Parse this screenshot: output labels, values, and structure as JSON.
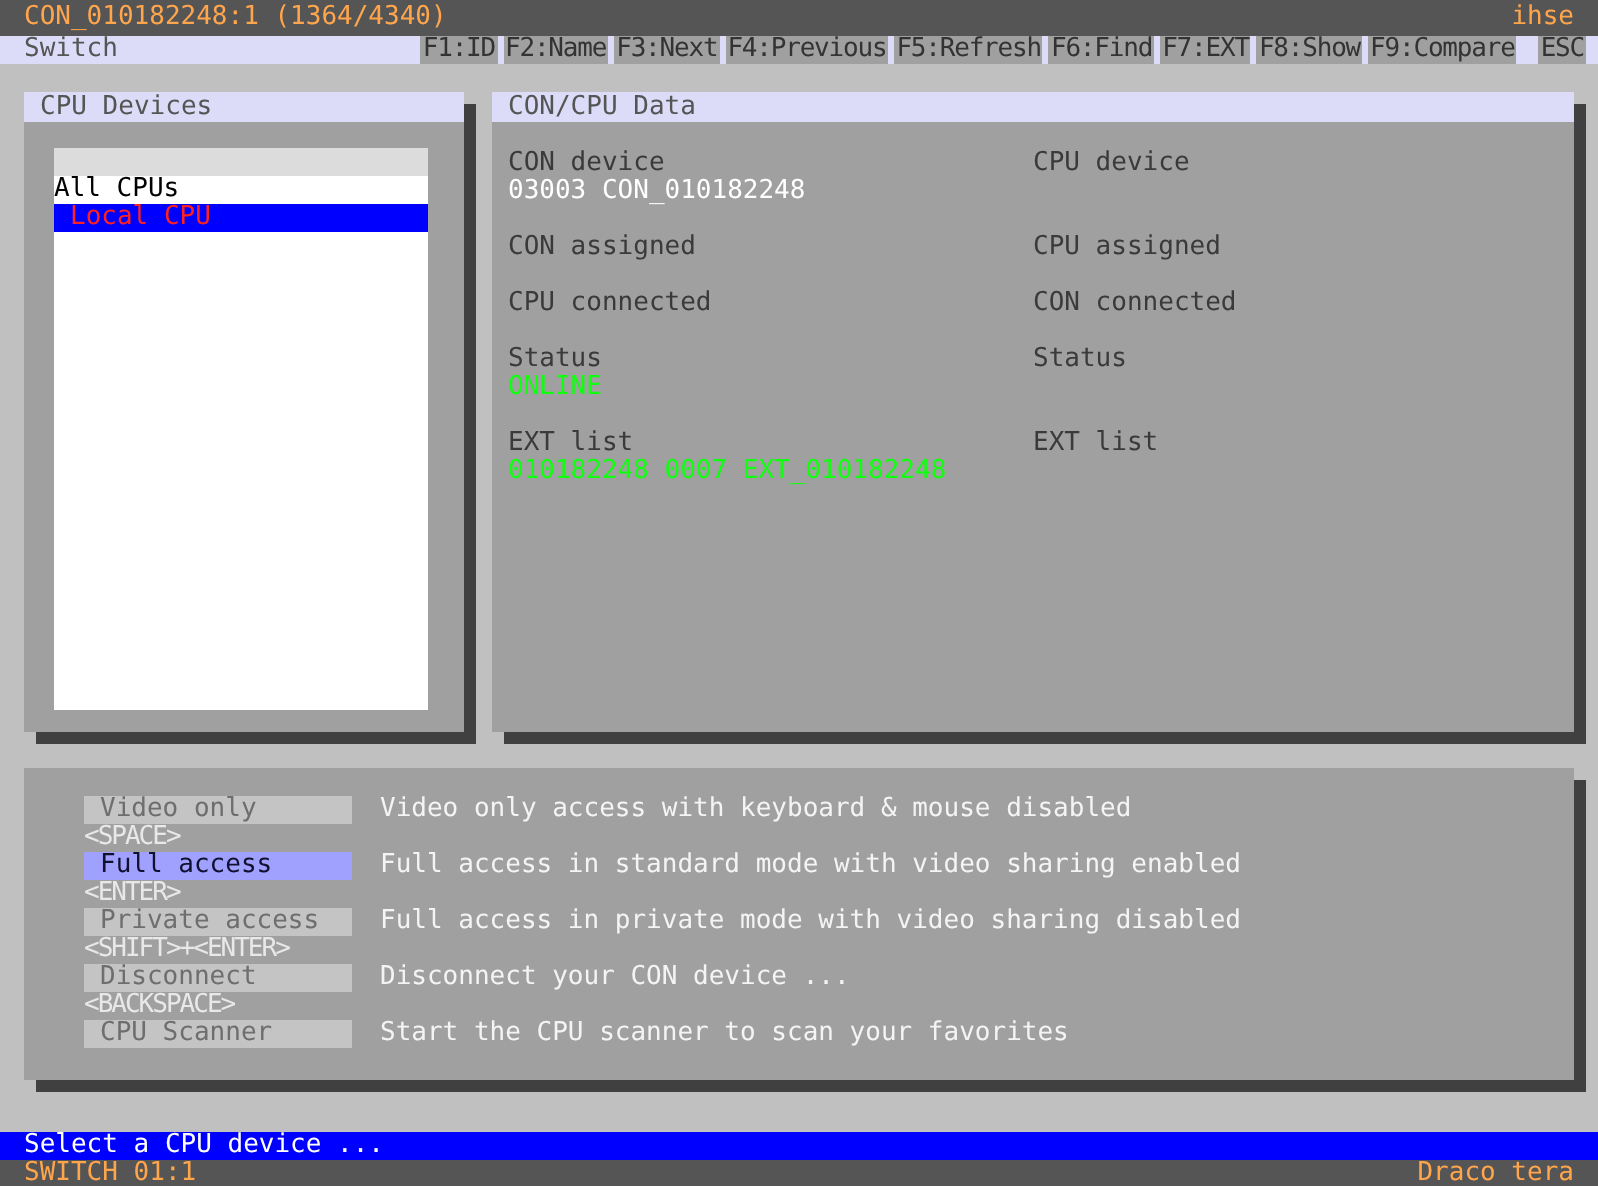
{
  "title_bar": {
    "title": "CON_010182248:1 (1364/4340)",
    "brand": "ihse"
  },
  "menu_bar": {
    "title": "Switch",
    "keys": [
      "F1:ID",
      "F2:Name",
      "F3:Next",
      "F4:Previous",
      "F5:Refresh",
      "F6:Find",
      "F7:EXT",
      "F8:Show",
      "F9:Compare",
      "ESC"
    ]
  },
  "cpu_devices": {
    "title": "CPU Devices",
    "items": [
      {
        "label": "All CPUs",
        "selected": false
      },
      {
        "label": "Local CPU",
        "selected": true
      }
    ]
  },
  "con_cpu_data": {
    "title": "CON/CPU Data",
    "rows": [
      [
        {
          "label": "CON device",
          "value": "03003 CON_010182248",
          "kind": "plain"
        },
        {
          "label": "CPU device"
        }
      ],
      [
        {
          "label": "CON assigned"
        },
        {
          "label": "CPU assigned"
        }
      ],
      [
        {
          "label": "CPU connected"
        },
        {
          "label": "CON connected"
        }
      ],
      [
        {
          "label": "Status",
          "value": "ONLINE",
          "kind": "ok"
        },
        {
          "label": "Status"
        }
      ],
      [
        {
          "label": "EXT list",
          "value": "010182248 0007 EXT_010182248",
          "kind": "ok"
        },
        {
          "label": "EXT list"
        }
      ]
    ]
  },
  "actions": [
    {
      "label": "Video only",
      "key": "<SPACE>",
      "description": "Video only access with keyboard & mouse disabled",
      "selected": false
    },
    {
      "label": "Full access",
      "key": "<ENTER>",
      "description": "Full access in standard mode with video sharing enabled",
      "selected": true
    },
    {
      "label": "Private access",
      "key": "<SHIFT>+<ENTER>",
      "description": "Full access in private mode with video sharing disabled",
      "selected": false
    },
    {
      "label": "Disconnect",
      "key": "<BACKSPACE>",
      "description": "Disconnect your CON device ...",
      "selected": false
    },
    {
      "label": "CPU Scanner",
      "description": "Start the CPU scanner to scan your favorites",
      "selected": false
    }
  ],
  "status_message": "Select a CPU device ...",
  "footer": {
    "left": "SWITCH 01:1",
    "right": "Draco tera"
  }
}
